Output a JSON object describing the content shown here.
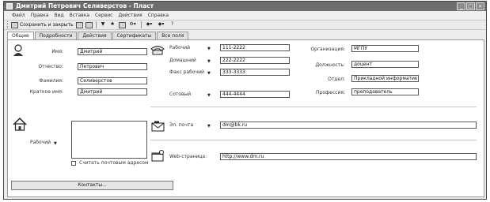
{
  "window": {
    "title": "Дмитрий Петрович Селиверстов - Пласт",
    "controls": [
      "_",
      "□",
      "×"
    ]
  },
  "menubar": [
    "Файл",
    "Правка",
    "Вид",
    "Вставка",
    "Сервис",
    "Действия",
    "Справка"
  ],
  "toolbar": {
    "save_label": "Сохранить и закрыть"
  },
  "tabs": [
    "Общие",
    "Подробности",
    "Действия",
    "Сертификаты",
    "Все поля"
  ],
  "active_tab": "Общие",
  "name": {
    "first_label": "Имя:",
    "first_value": "Дмитрий",
    "middle_label": "Отчество:",
    "middle_value": "Петрович",
    "last_label": "Фамилия:",
    "last_value": "Селиверстов",
    "short_label": "Краткое имя:",
    "short_value": "Дмитрий"
  },
  "phones": {
    "work_label": "Рабочий",
    "work_value": "111-2222",
    "home_label": "Домашний",
    "home_value": "222-2222",
    "fax_label": "Факс рабочий",
    "fax_value": "333-3333",
    "mobile_label": "Сотовый",
    "mobile_value": "444-4444"
  },
  "org": {
    "org_label": "Организация:",
    "org_value": "МГПУ",
    "position_label": "Должность:",
    "position_value": "доцент",
    "dept_label": "Отдел:",
    "dept_value": "Прикладной информатики",
    "profession_label": "Профессия:",
    "profession_value": "преподаватель"
  },
  "address": {
    "label": "Рабочий",
    "checkbox_label": "Считать почтовым адресом"
  },
  "email": {
    "label": "Эл. почта",
    "value": "dm@bk.ru"
  },
  "web": {
    "label": "Web-страница:",
    "value": "http://www.dm.ru"
  },
  "contacts_button": "Контакты..."
}
